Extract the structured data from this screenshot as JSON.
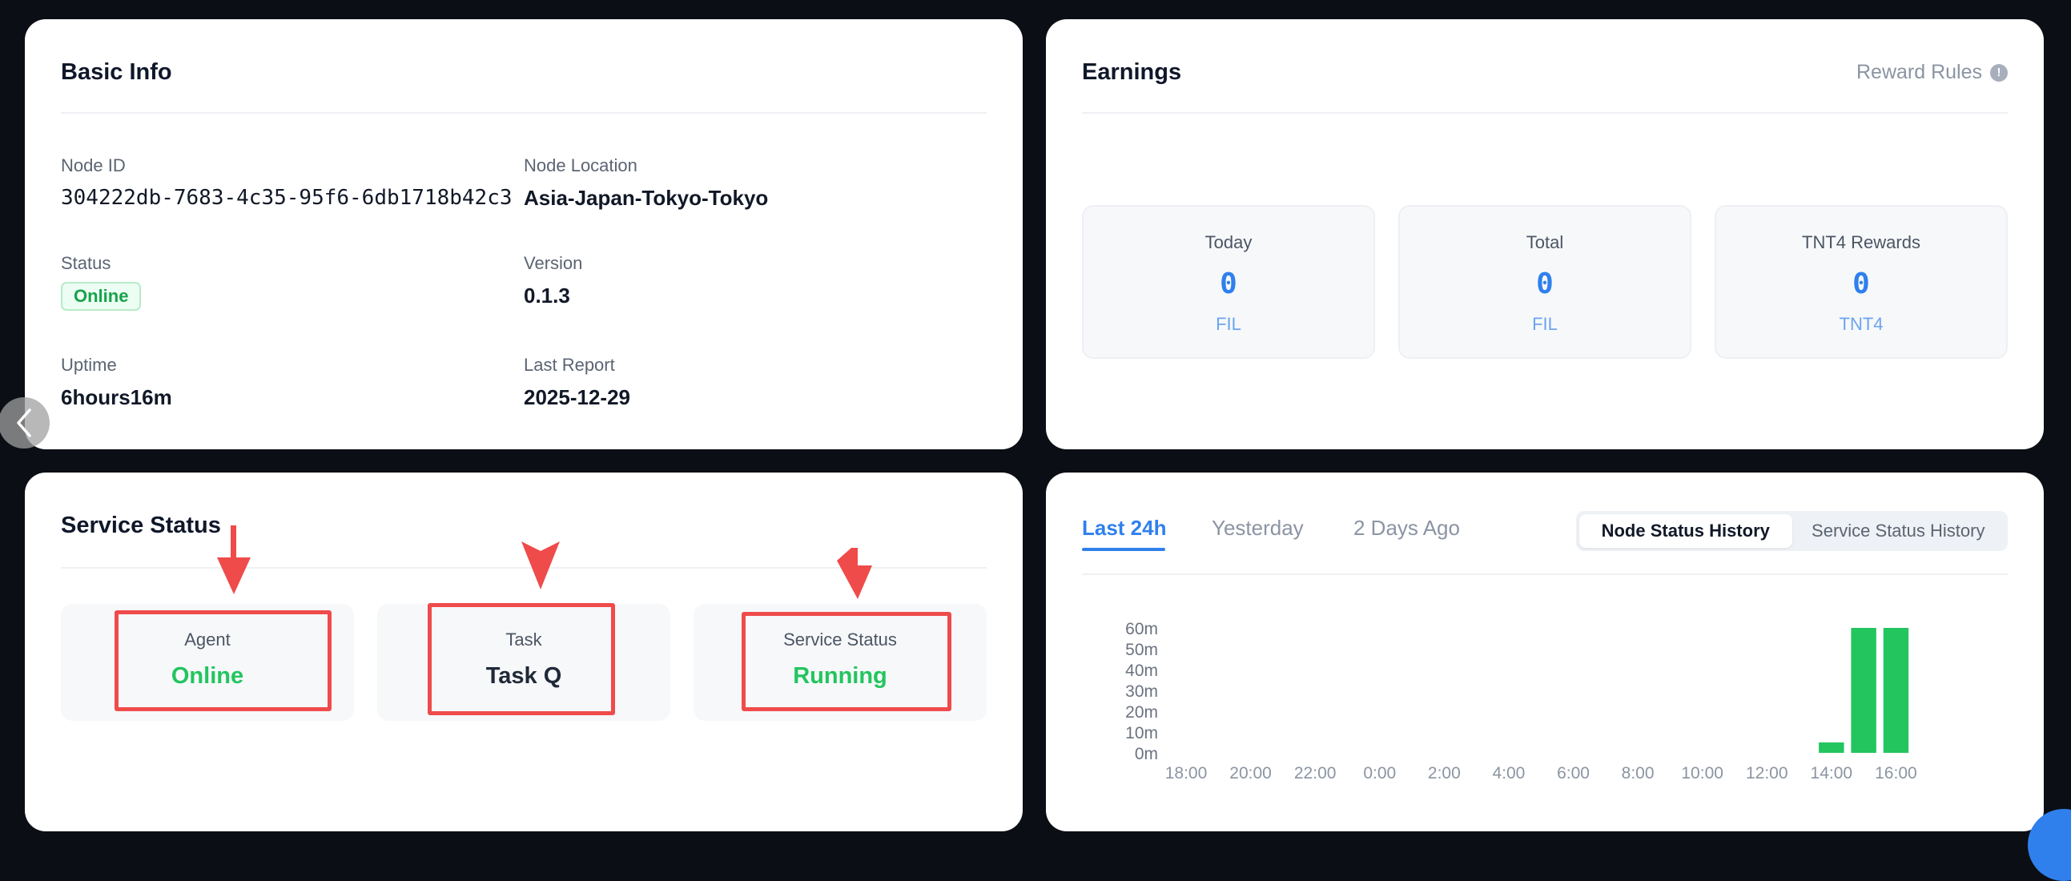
{
  "basic_info": {
    "title": "Basic Info",
    "node_id_label": "Node ID",
    "node_id": "304222db-7683-4c35-95f6-6db1718b42c3",
    "location_label": "Node Location",
    "location": "Asia-Japan-Tokyo-Tokyo",
    "status_label": "Status",
    "status": "Online",
    "version_label": "Version",
    "version": "0.1.3",
    "uptime_label": "Uptime",
    "uptime": "6hours16m",
    "last_report_label": "Last Report",
    "last_report": "2025-12-29"
  },
  "earnings": {
    "title": "Earnings",
    "reward_rules": "Reward Rules",
    "info_icon": "!",
    "boxes": [
      {
        "label": "Today",
        "value": "0",
        "unit": "FIL"
      },
      {
        "label": "Total",
        "value": "0",
        "unit": "FIL"
      },
      {
        "label": "TNT4 Rewards",
        "value": "0",
        "unit": "TNT4"
      }
    ]
  },
  "service_status": {
    "title": "Service Status",
    "items": [
      {
        "label": "Agent",
        "value": "Online"
      },
      {
        "label": "Task",
        "value": "Task Q"
      },
      {
        "label": "Service Status",
        "value": "Running"
      }
    ],
    "annotation_color": "#ef4b4b"
  },
  "history": {
    "tabs": [
      "Last 24h",
      "Yesterday",
      "2 Days Ago"
    ],
    "active_tab": "Last 24h",
    "segments": [
      "Node Status History",
      "Service Status History"
    ],
    "active_segment": "Node Status History"
  },
  "colors": {
    "accent": "#2f80ed",
    "success": "#22c55e",
    "annotation": "#ef4b4b"
  },
  "chart_data": {
    "type": "bar",
    "title": "",
    "xlabel": "",
    "ylabel": "",
    "y_unit": "m",
    "ylim": [
      0,
      60
    ],
    "y_ticks": [
      "0m",
      "10m",
      "20m",
      "30m",
      "40m",
      "50m",
      "60m"
    ],
    "x_ticks": [
      "18:00",
      "20:00",
      "22:00",
      "0:00",
      "2:00",
      "4:00",
      "6:00",
      "8:00",
      "10:00",
      "12:00",
      "14:00",
      "16:00"
    ],
    "x_range_hours": [
      18,
      42
    ],
    "bar_color": "#22c55e",
    "categories": [
      "14:00",
      "15:00",
      "16:00"
    ],
    "bar_x_hours": [
      38.0,
      39.0,
      40.0
    ],
    "values": [
      5,
      60,
      60
    ],
    "grid": false,
    "legend": "none"
  }
}
